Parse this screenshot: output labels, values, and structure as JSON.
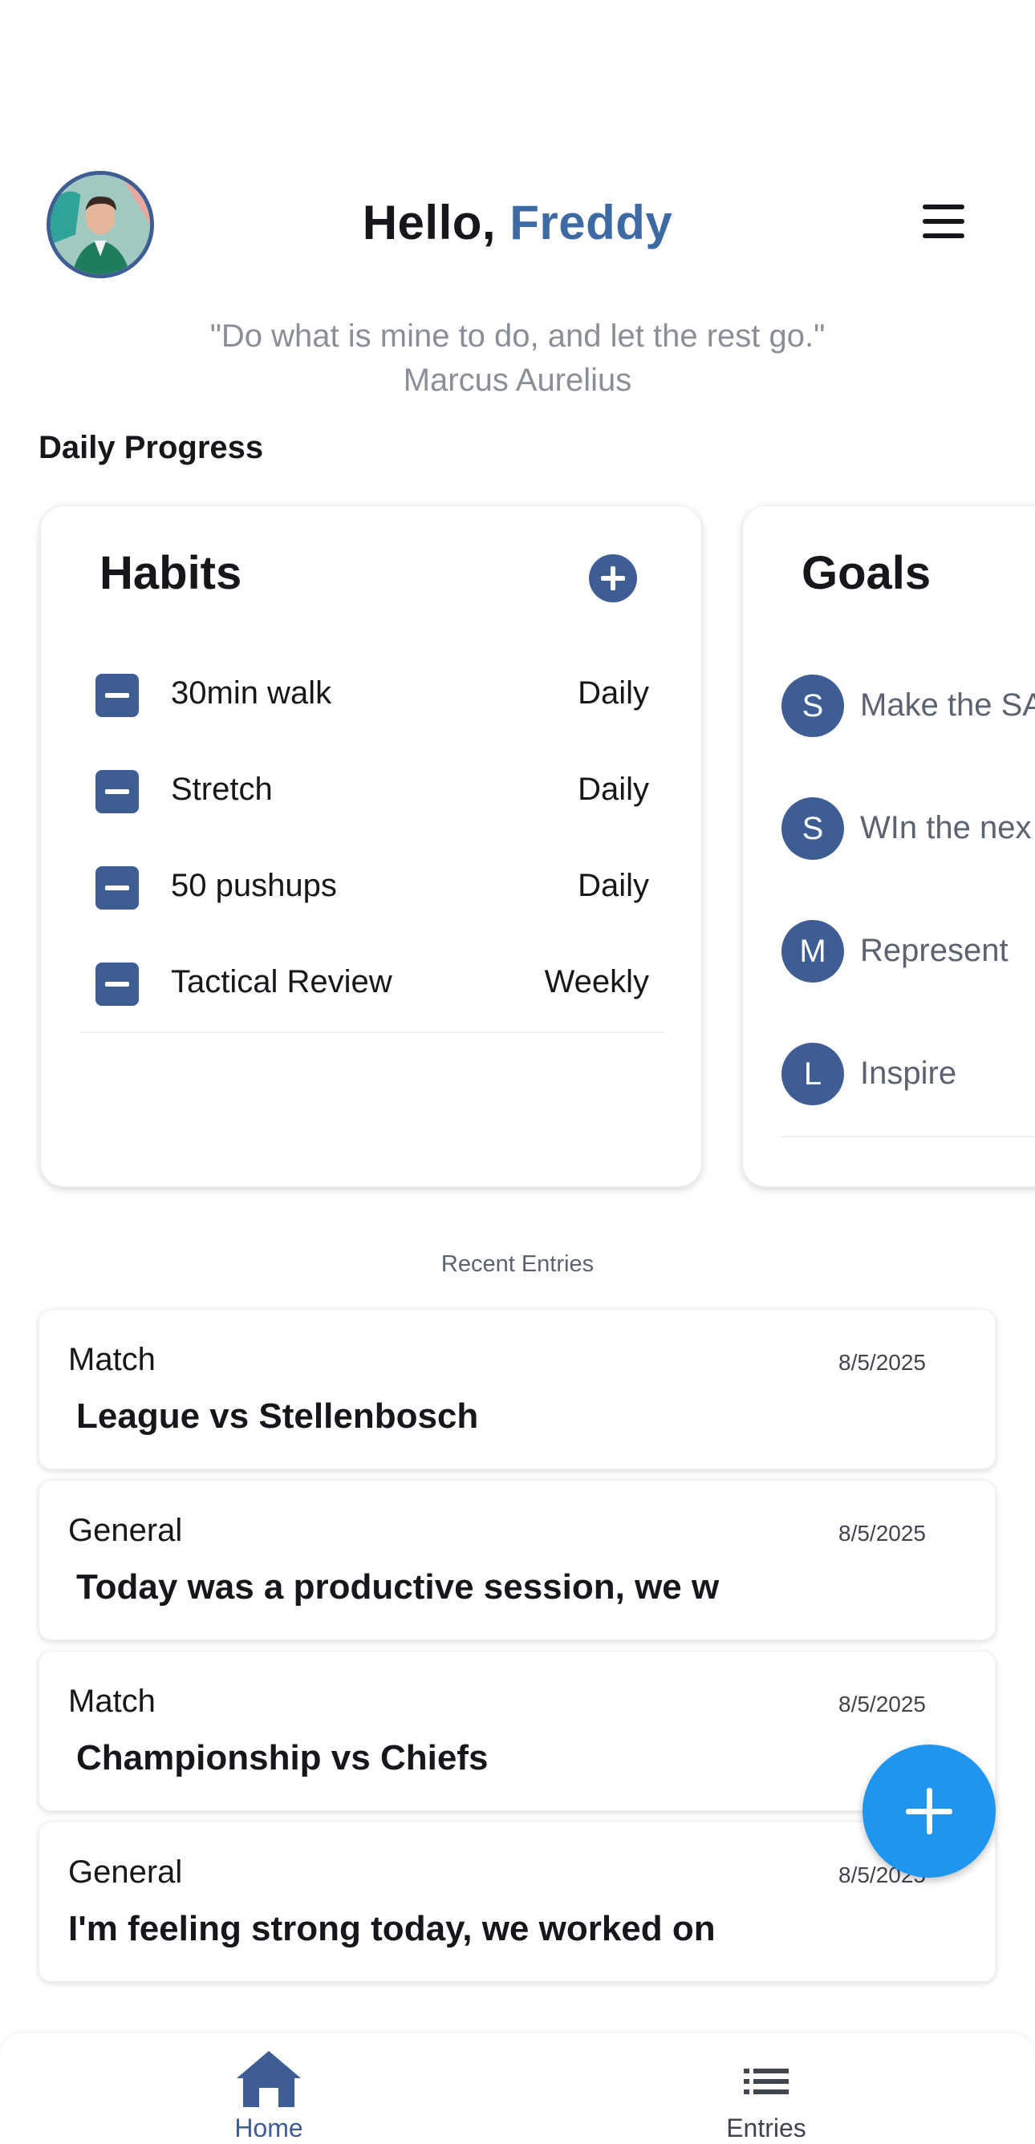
{
  "header": {
    "greeting": "Hello,",
    "user_name": "Freddy"
  },
  "quote": {
    "text": "\"Do what is mine to do, and let the rest go.\"",
    "author": "Marcus Aurelius"
  },
  "daily_progress": {
    "title": "Daily Progress",
    "habits": {
      "title": "Habits",
      "items": [
        {
          "name": "30min walk",
          "frequency": "Daily"
        },
        {
          "name": "Stretch",
          "frequency": "Daily"
        },
        {
          "name": "50 pushups",
          "frequency": "Daily"
        },
        {
          "name": "Tactical Review",
          "frequency": "Weekly"
        }
      ]
    },
    "goals": {
      "title": "Goals",
      "items": [
        {
          "initial": "S",
          "text": "Make the SA"
        },
        {
          "initial": "S",
          "text": "WIn the nex"
        },
        {
          "initial": "M",
          "text": "Represent"
        },
        {
          "initial": "L",
          "text": "Inspire"
        }
      ]
    }
  },
  "recent_entries": {
    "label": "Recent Entries",
    "items": [
      {
        "type": "Match",
        "date": "8/5/2025",
        "title": "League vs Stellenbosch"
      },
      {
        "type": "General",
        "date": "8/5/2025",
        "title": "Today was a productive session, we w"
      },
      {
        "type": "Match",
        "date": "8/5/2025",
        "title": "Championship vs Chiefs"
      },
      {
        "type": "General",
        "date": "8/5/2025",
        "title": "I'm feeling strong today, we worked on"
      }
    ]
  },
  "bottom_nav": {
    "home_label": "Home",
    "entries_label": "Entries"
  },
  "colors": {
    "accent": "#3d5d93",
    "name_blue": "#3d6aa3",
    "fab": "#1e95ee",
    "quote_gray": "#8a8f97"
  },
  "icons": [
    "menu-icon",
    "plus-icon",
    "minus-checkbox-icon",
    "home-icon",
    "list-icon"
  ]
}
